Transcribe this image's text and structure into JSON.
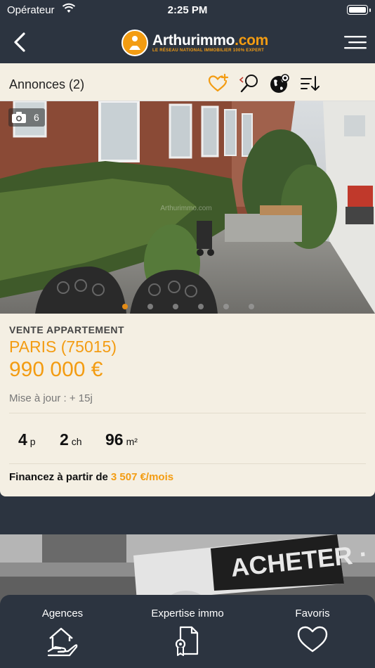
{
  "status_bar": {
    "carrier": "Opérateur",
    "time": "2:25 PM"
  },
  "navbar": {
    "logo_main": "Arthurimmo",
    "logo_tld": ".com",
    "logo_tagline": "LE RÉSEAU NATIONAL IMMOBILIER 100% EXPERT"
  },
  "toolbar": {
    "title": "Annonces (2)",
    "icons": [
      "favorite-add-icon",
      "search-icon",
      "map-icon",
      "sort-icon"
    ]
  },
  "photo": {
    "count": "6",
    "dots": 6,
    "active_dot": 0,
    "watermark": "Arthurimmo.com"
  },
  "listing": {
    "type": "VENTE APPARTEMENT",
    "city": "PARIS (75015)",
    "price": "990 000 €",
    "updated": "Mise à jour : + 15j",
    "rooms_value": "4",
    "rooms_unit": "p",
    "bedrooms_value": "2",
    "bedrooms_unit": "ch",
    "area_value": "96",
    "area_unit": "m²",
    "finance_label": "Financez à partir de",
    "finance_amount": "3 507 €/mois"
  },
  "second_photo_text": "ACHETER · LOUER · FR",
  "tabs": [
    {
      "label": "Agences"
    },
    {
      "label": "Expertise immo"
    },
    {
      "label": "Favoris"
    }
  ],
  "colors": {
    "accent": "#f39c12",
    "navbar": "#2c3440",
    "card": "#f4efe3"
  }
}
